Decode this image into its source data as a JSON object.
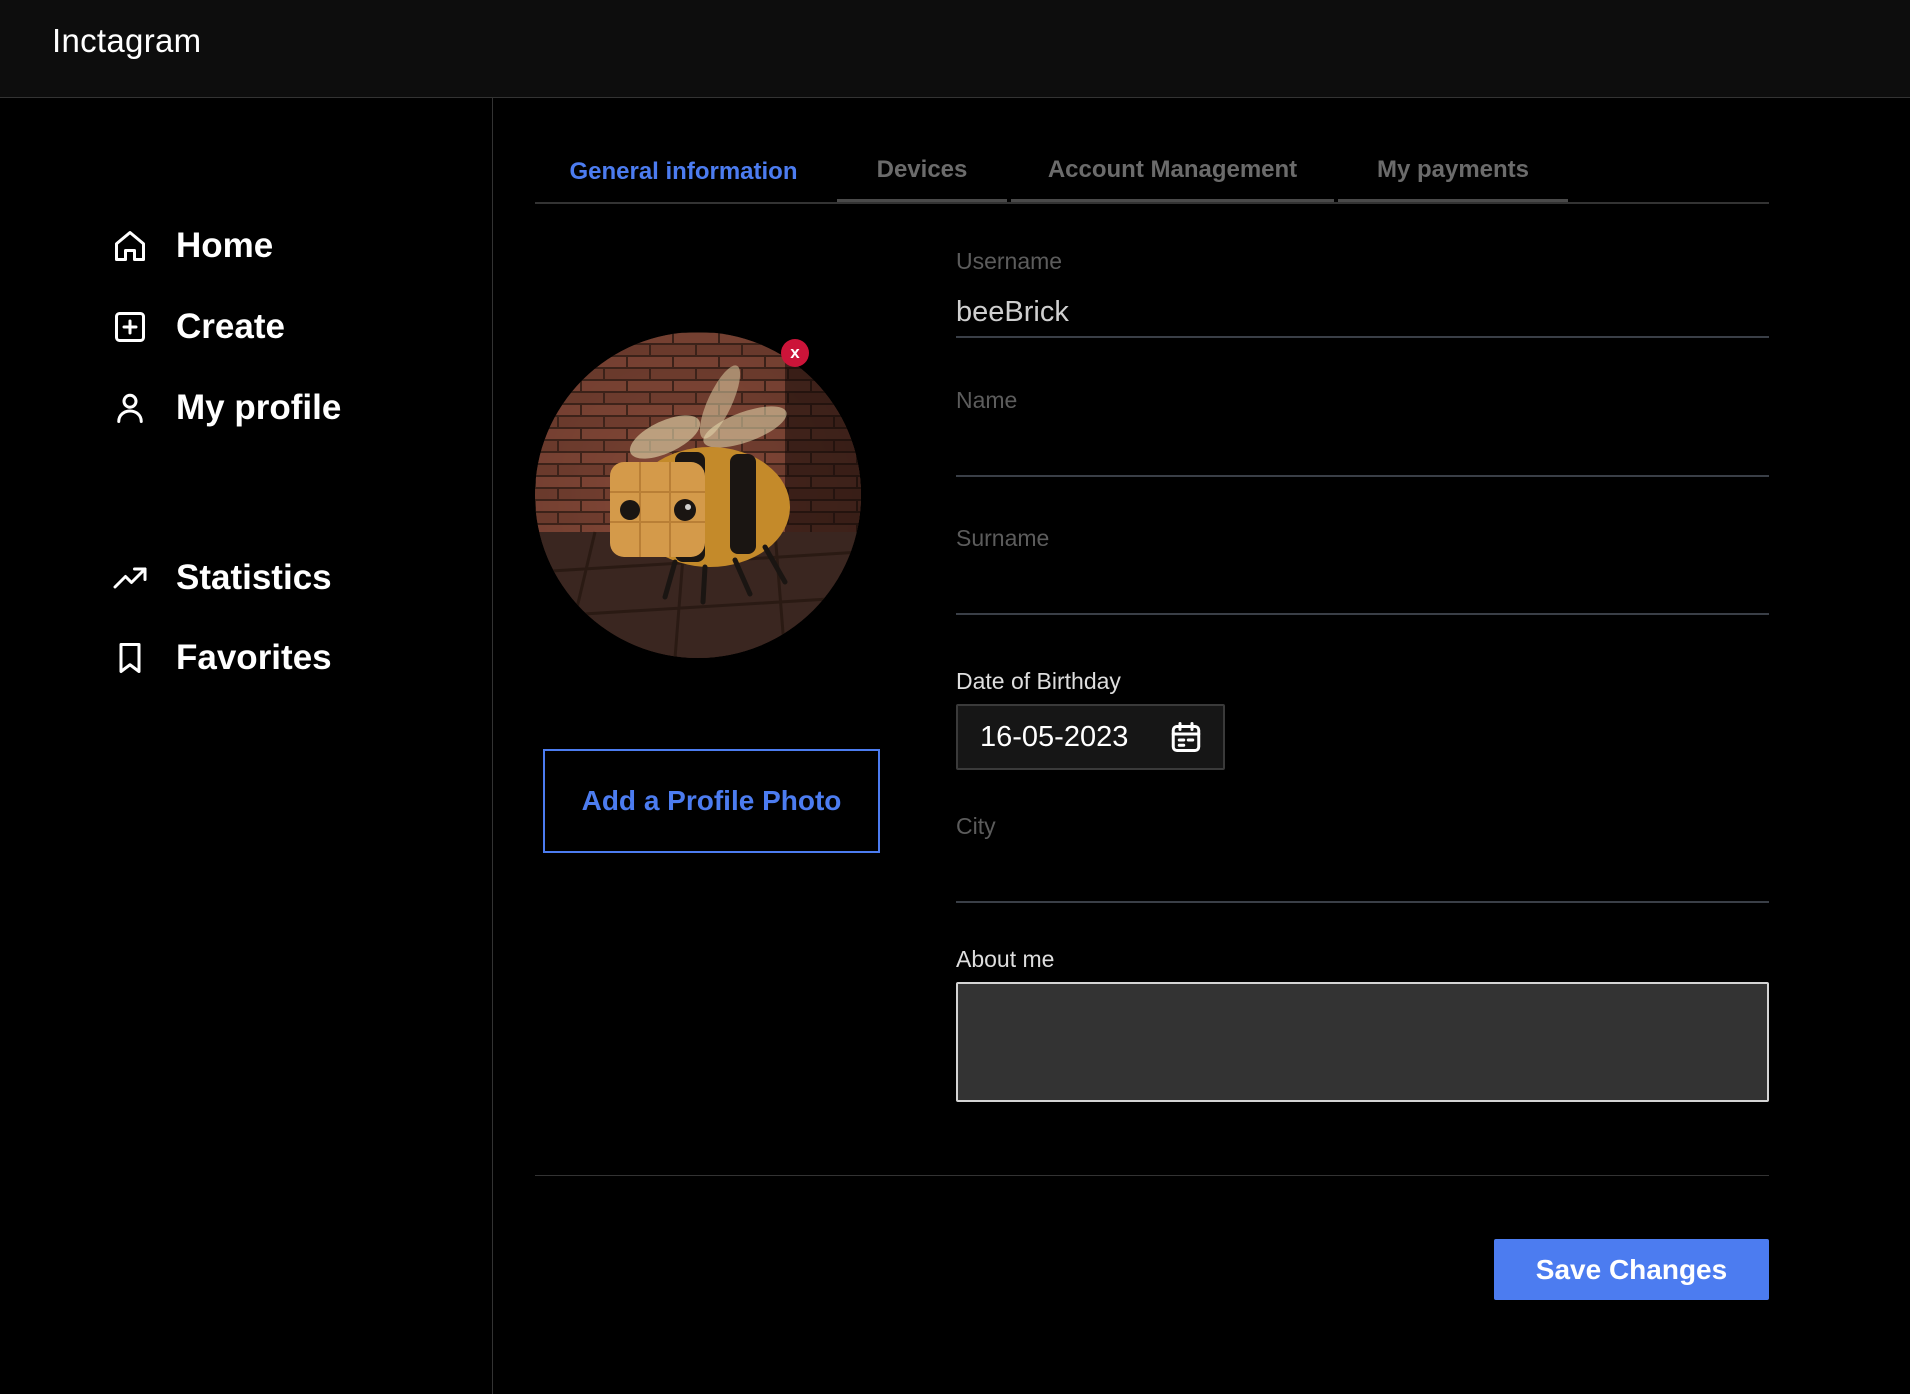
{
  "app": {
    "title": "Inctagram"
  },
  "sidebar": {
    "items": [
      {
        "label": "Home",
        "icon": "home-icon"
      },
      {
        "label": "Create",
        "icon": "plus-square-icon"
      },
      {
        "label": "My profile",
        "icon": "user-icon"
      },
      {
        "label": "Statistics",
        "icon": "trending-up-icon"
      },
      {
        "label": "Favorites",
        "icon": "bookmark-icon"
      }
    ]
  },
  "tabs": [
    {
      "label": "General information",
      "active": true
    },
    {
      "label": "Devices",
      "active": false
    },
    {
      "label": "Account Management",
      "active": false
    },
    {
      "label": "My payments",
      "active": false
    }
  ],
  "profile": {
    "remove_photo_label": "x",
    "add_photo_label": "Add a Profile Photo"
  },
  "form": {
    "username": {
      "label": "Username",
      "value": "beeBrick"
    },
    "name": {
      "label": "Name",
      "value": ""
    },
    "surname": {
      "label": "Surname",
      "value": ""
    },
    "birthday": {
      "label": "Date of Birthday",
      "value": "16-05-2023",
      "icon": "calendar-icon"
    },
    "city": {
      "label": "City",
      "value": ""
    },
    "about": {
      "label": "About me",
      "value": ""
    }
  },
  "actions": {
    "save_label": "Save Changes"
  },
  "colors": {
    "accent": "#4c7cf0",
    "danger": "#cc1439",
    "background": "#000000",
    "header": "#0d0d0d"
  }
}
